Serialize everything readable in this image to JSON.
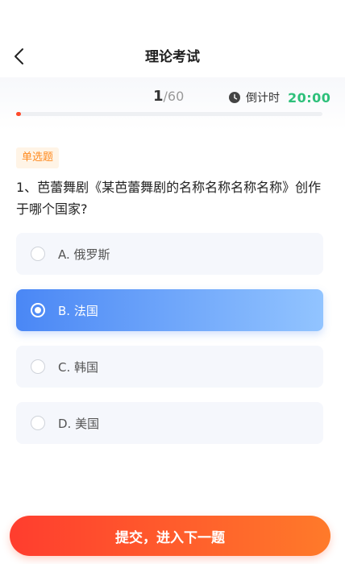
{
  "header": {
    "title": "理论考试",
    "back_icon": "chevron-left-icon"
  },
  "progress": {
    "current": "1",
    "separator_total": "/60",
    "fraction": 0.0167,
    "timer_icon": "clock-icon",
    "timer_label": "倒计时",
    "timer_value": "20:00"
  },
  "question": {
    "type_badge": "单选题",
    "text": "1、芭蕾舞剧《某芭蕾舞剧的名称名称名称名称》创作于哪个国家?"
  },
  "options": [
    {
      "label": "A. 俄罗斯",
      "selected": false
    },
    {
      "label": "B. 法国",
      "selected": true
    },
    {
      "label": "C. 韩国",
      "selected": false
    },
    {
      "label": "D. 美国",
      "selected": false
    }
  ],
  "submit": {
    "label": "提交，进入下一题"
  },
  "colors": {
    "accent_red": "#ff4a2b",
    "timer_green": "#2ec07a",
    "selected_blue": "#4a87f5",
    "badge_orange": "#ff8a1f"
  }
}
